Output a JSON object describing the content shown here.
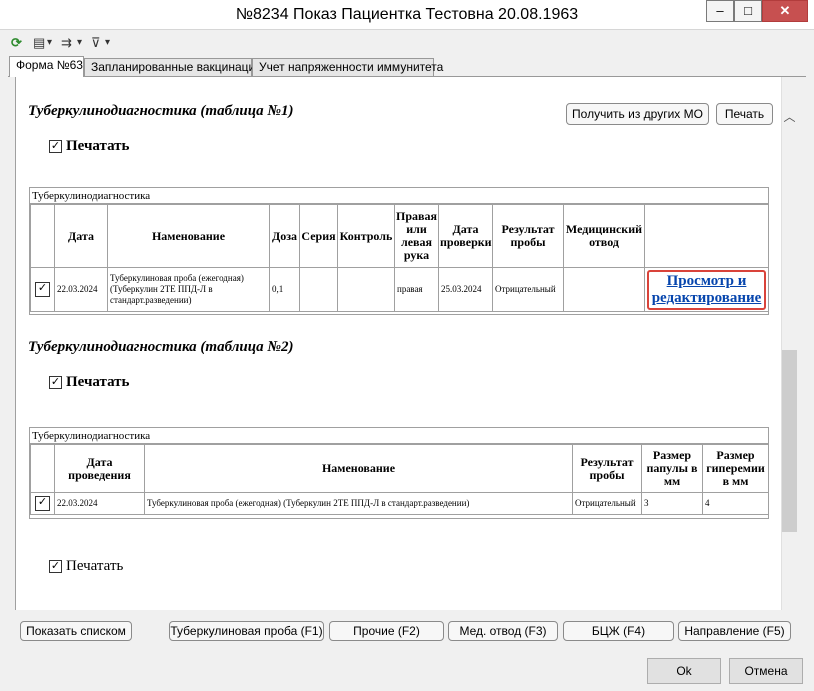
{
  "window": {
    "title": "№8234 Показ Пациентка Тестовна 20.08.1963",
    "minimize": "–",
    "maximize": "□",
    "close": "✕"
  },
  "toolbar": {
    "refresh_icon": "⟳",
    "print_icon": "▤",
    "export_icon": "⇉",
    "filter_icon": "⊽",
    "dropdown": "▾"
  },
  "tabs": [
    {
      "label": "Форма №63"
    },
    {
      "label": "Запланированные вакцинации"
    },
    {
      "label": "Учет напряженности иммунитета"
    }
  ],
  "section1": {
    "title": "Туберкулинодиагностика (таблица №1)",
    "get_from_mo": "Получить из других МО",
    "print_btn": "Печать",
    "print_check_label": "Печатать",
    "grid_caption": "Туберкулинодиагностика",
    "headers": [
      "Дата",
      "Наменование",
      "Доза",
      "Серия",
      "Контроль",
      "Правая или левая рука",
      "Дата проверки",
      "Результат пробы",
      "Медицинский отвод"
    ],
    "row": {
      "date": "22.03.2024",
      "name": "Туберкулиновая проба (ежегодная) (Туберкулин 2ТЕ ППД-Л в стандарт.разведении)",
      "dose": "0,1",
      "series": "",
      "control": "",
      "hand": "правая",
      "check_date": "25.03.2024",
      "result": "Отрицательный",
      "med_exemption": "",
      "link": "Просмотр и редактирование"
    }
  },
  "section2": {
    "title": "Туберкулинодиагностика (таблица №2)",
    "print_check_label": "Печатать",
    "grid_caption": "Туберкулинодиагностика",
    "headers": [
      "Дата проведения",
      "Наменование",
      "Результат пробы",
      "Размер папулы в мм",
      "Размер гиперемии в мм"
    ],
    "row": {
      "date": "22.03.2024",
      "name": "Туберкулиновая проба (ежегодная) (Туберкулин 2ТЕ ППД-Л в стандарт.разведении)",
      "result": "Отрицательный",
      "papule": "3",
      "hyperemia": "4"
    }
  },
  "section3": {
    "print_check_label": "Печатать"
  },
  "bottom_buttons": {
    "show_list": "Показать списком",
    "tuberculin": "Туберкулиновая проба (F1)",
    "other": "Прочие (F2)",
    "med_exemption": "Мед. отвод (F3)",
    "bcg": "БЦЖ (F4)",
    "referral": "Направление (F5)"
  },
  "dialog": {
    "ok": "Ok",
    "cancel": "Отмена"
  },
  "check_mark": "✓",
  "scroll_up": "︿"
}
